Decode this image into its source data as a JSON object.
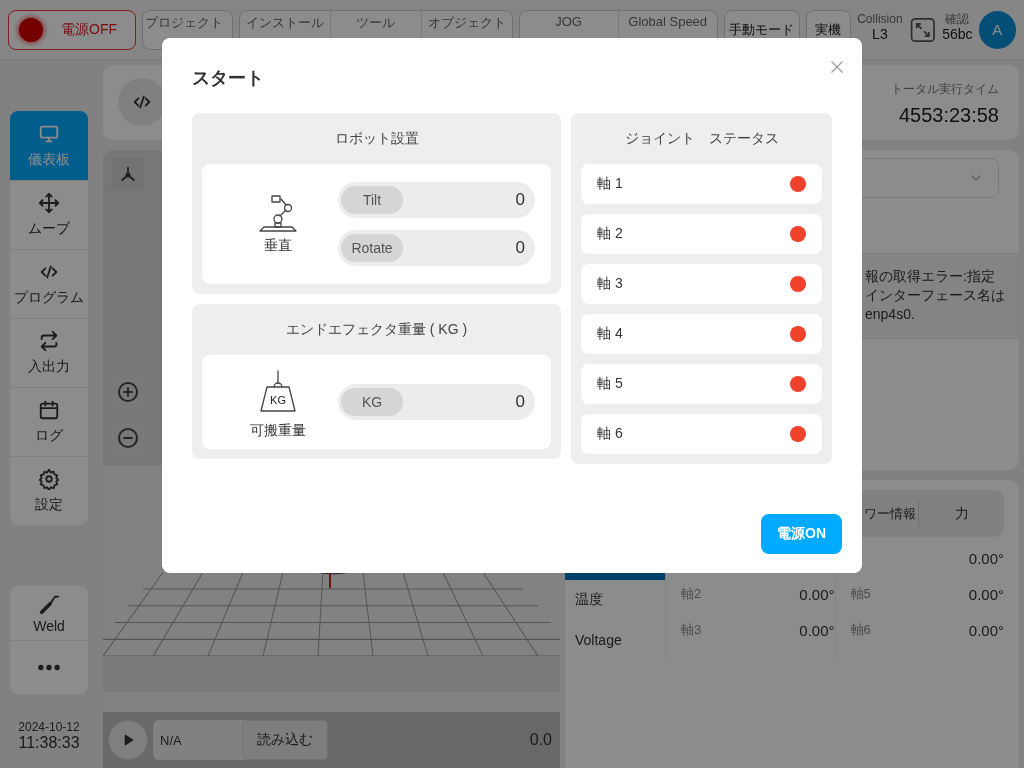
{
  "top_bar": {
    "power_button": {
      "label": "電源OFF"
    },
    "status_groups": [
      {
        "items": [
          {
            "label": "プロジェクト"
          }
        ]
      },
      {
        "items": [
          {
            "label": "インストール"
          },
          {
            "label": "ツール"
          },
          {
            "label": "オブジェクト"
          }
        ]
      },
      {
        "items": [
          {
            "label": "JOG"
          },
          {
            "label": "Global Speed"
          }
        ]
      }
    ],
    "mode_buttons": [
      "手動モード",
      "実機"
    ],
    "collision": {
      "label": "Collision",
      "value": "L3"
    },
    "confirm": {
      "label": "確認",
      "value": "56bc"
    },
    "avatar": "A"
  },
  "sidebar": {
    "items": [
      {
        "label": "儀表板",
        "selected": true
      },
      {
        "label": "ムーブ",
        "selected": false
      },
      {
        "label": "プログラム",
        "selected": false
      },
      {
        "label": "入出力",
        "selected": false
      },
      {
        "label": "ログ",
        "selected": false
      },
      {
        "label": "設定",
        "selected": false
      }
    ],
    "tools": [
      {
        "kind": "weld",
        "label": "Weld"
      },
      {
        "kind": "more"
      }
    ],
    "date": "2024-10-12",
    "time": "11:38:33"
  },
  "player": {
    "program_field": "N/A",
    "load_button": "読み込む",
    "reading": "0.0"
  },
  "right": {
    "runtime": {
      "label": "トータル実行タイム",
      "value": "4553:23:58"
    },
    "error_lines": [
      "報の取得エラー:指定",
      "インターフェース名は",
      "enp4s0."
    ],
    "info_tabs": [
      {
        "label": "ワー情報",
        "selected": false
      },
      {
        "label": "力",
        "selected": false
      }
    ],
    "side_tabs": [
      {
        "selected": true
      },
      {
        "label": "温度",
        "selected": false
      },
      {
        "label": "Voltage",
        "selected": false
      }
    ],
    "joint_columns": [
      {
        "items": [
          {
            "axis": "軸2",
            "value": "0.00°"
          },
          {
            "axis": "軸3",
            "value": "0.00°"
          }
        ]
      },
      {
        "items": [
          {
            "value": "0.00°"
          },
          {
            "axis": "軸5",
            "value": "0.00°"
          },
          {
            "axis": "軸6",
            "value": "0.00°"
          }
        ]
      }
    ]
  },
  "modal": {
    "title": "スタート",
    "robot_setup": {
      "title": "ロボット設置",
      "mount_label": "垂直",
      "fields": [
        {
          "label": "Tilt",
          "value": "0"
        },
        {
          "label": "Rotate",
          "value": "0"
        }
      ]
    },
    "payload": {
      "title": "エンドエフェクタ重量 ( KG )",
      "icon_text": "KG",
      "label": "可搬重量",
      "fields": [
        {
          "label": "KG",
          "value": "0"
        }
      ]
    },
    "joint_status": {
      "title": "ジョイント　ステータス",
      "joints": [
        {
          "label": "軸 1",
          "color": "#f0412d"
        },
        {
          "label": "軸 2",
          "color": "#f0412d"
        },
        {
          "label": "軸 3",
          "color": "#f0412d"
        },
        {
          "label": "軸 4",
          "color": "#f0412d"
        },
        {
          "label": "軸 5",
          "color": "#f0412d"
        },
        {
          "label": "軸 6",
          "color": "#f0412d"
        }
      ]
    },
    "primary_button": "電源ON"
  }
}
